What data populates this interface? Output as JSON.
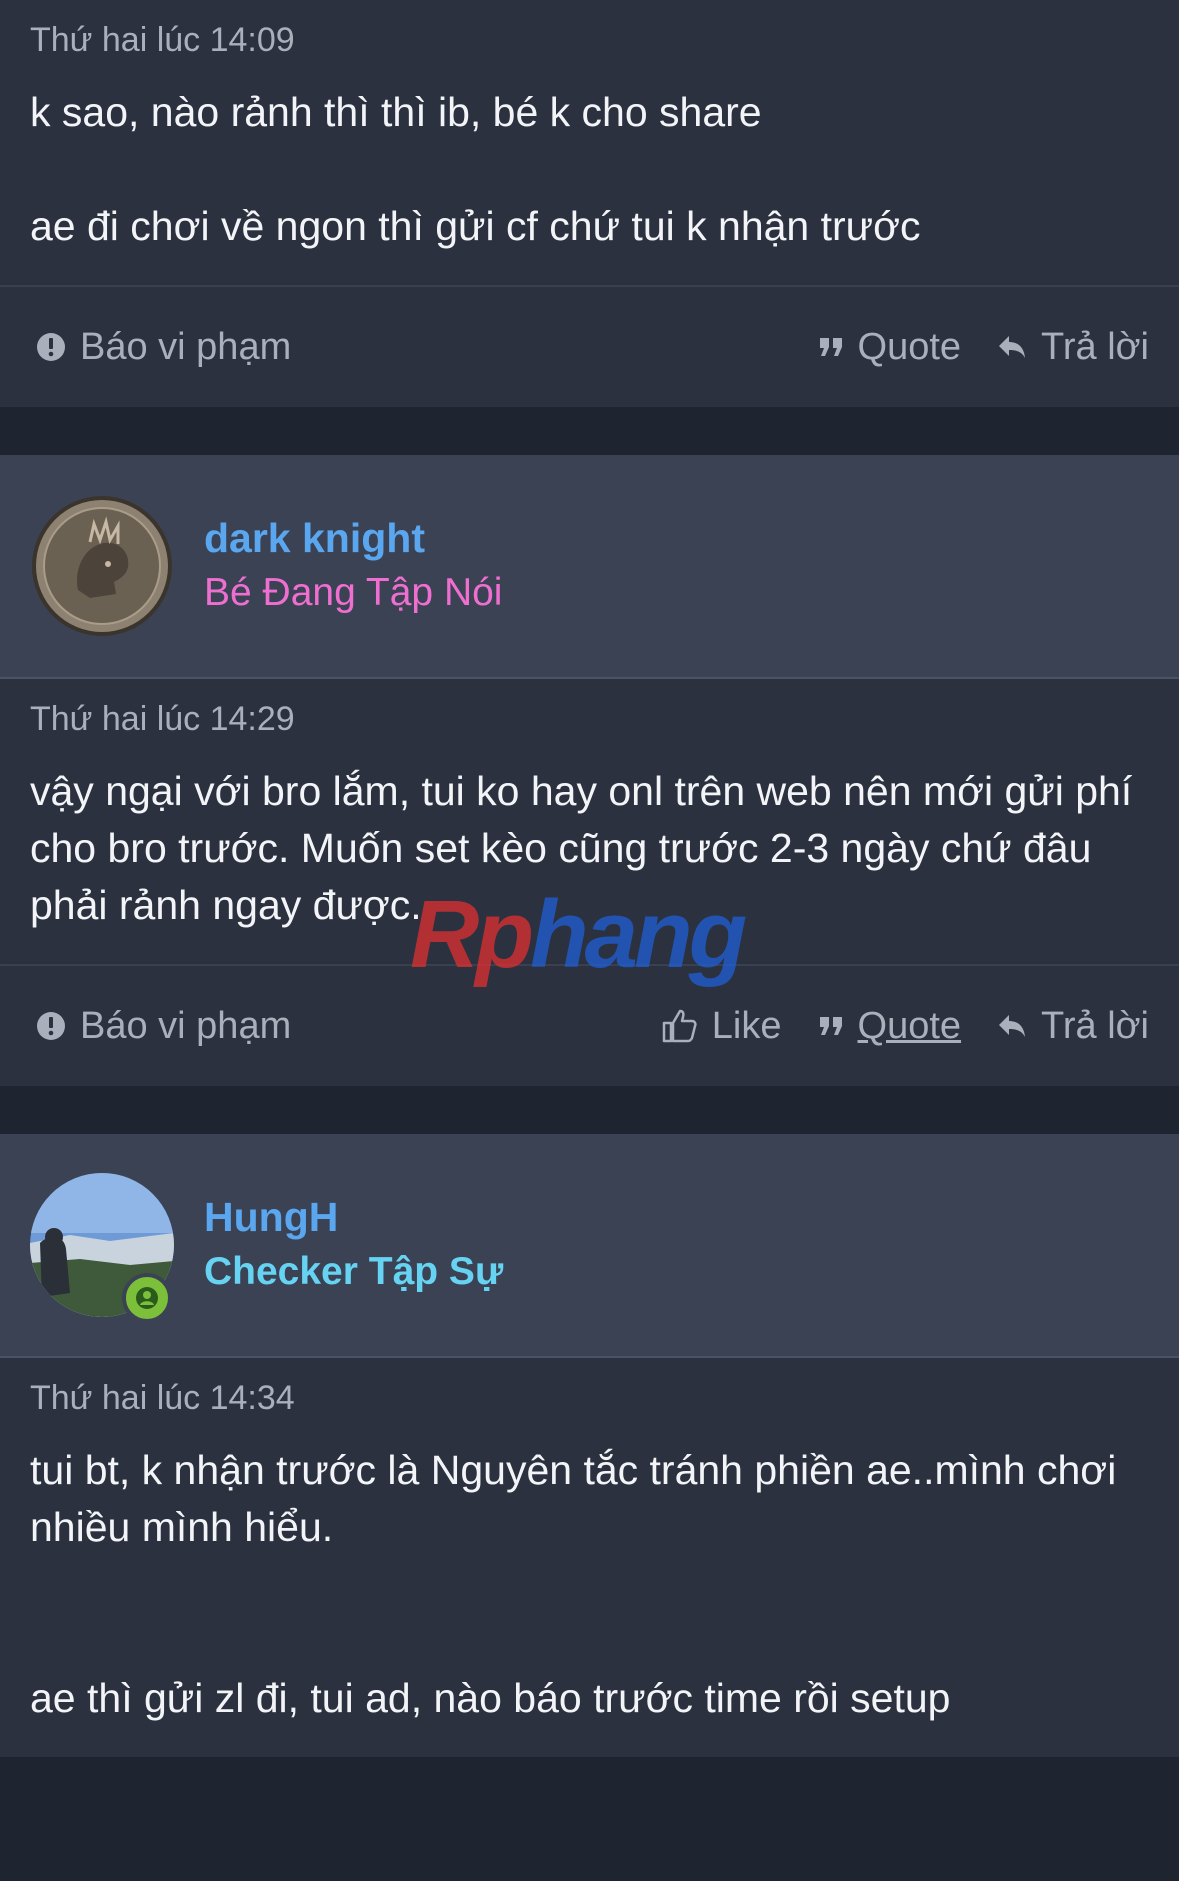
{
  "post1": {
    "timestamp": "Thứ hai lúc 14:09",
    "lines": [
      "k sao, nào rảnh thì thì ib, bé k cho share",
      "ae đi chơi về ngon thì gửi cf chứ tui k nhận trước"
    ]
  },
  "post1_actions": {
    "report": "Báo vi phạm",
    "quote": "Quote",
    "reply": "Trả lời"
  },
  "author2": {
    "name": "dark knight",
    "title": "Bé Đang Tập Nói"
  },
  "post2": {
    "timestamp": "Thứ hai lúc 14:29",
    "lines": [
      "vậy ngại với bro lắm, tui ko hay onl trên web nên mới gửi phí",
      "cho bro trước. Muốn set kèo cũng trước 2-3 ngày chứ đâu",
      "phải rảnh ngay được."
    ]
  },
  "post2_actions": {
    "report": "Báo vi phạm",
    "like": "Like",
    "quote": "Quote",
    "reply": "Trả lời"
  },
  "author3": {
    "name": "HungH",
    "title": "Checker Tập Sự"
  },
  "post3": {
    "timestamp": "Thứ hai lúc 14:34",
    "lines": [
      "tui bt, k nhận trước là Nguyên tắc tránh phiền ae..mình chơi",
      "nhiều mình hiểu.",
      "ae thì gửi zl đi, tui ad, nào báo trước time rồi setup"
    ]
  },
  "watermark": {
    "part1": "Rp",
    "part2": "hang"
  },
  "colors": {
    "background": "#1f2530",
    "card": "#2b313e",
    "author_bg": "#3a4254",
    "username": "#5aa7f0",
    "title_pink": "#ee6fd0",
    "title_cyan": "#67d3f2",
    "online": "#7bbf3b"
  }
}
